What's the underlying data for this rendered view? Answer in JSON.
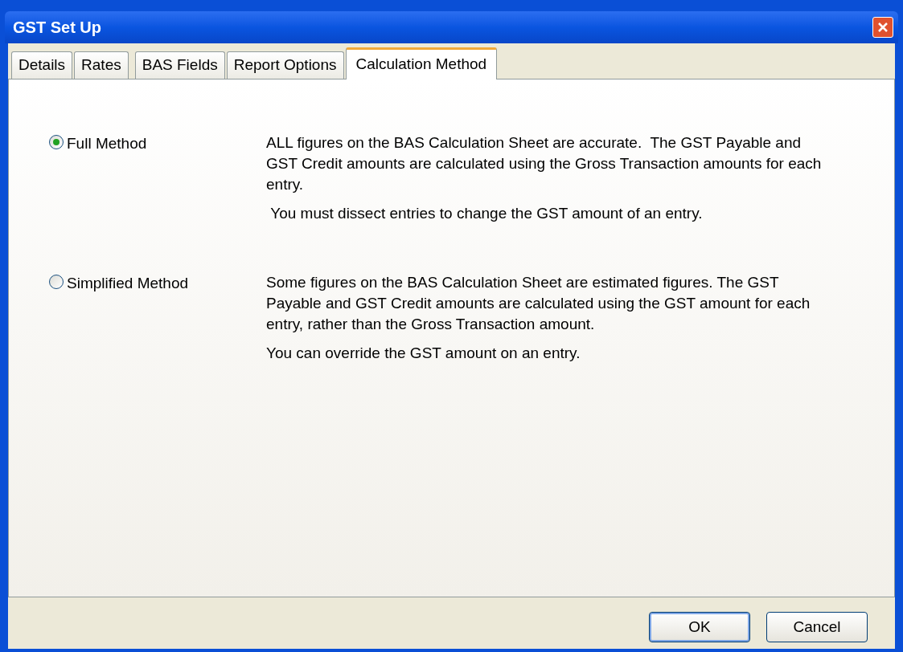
{
  "window": {
    "title": "GST Set Up"
  },
  "tabs": [
    {
      "label": "Details",
      "selected": false
    },
    {
      "label": "Rates",
      "selected": false
    },
    {
      "label": "BAS Fields",
      "selected": false
    },
    {
      "label": "Report Options",
      "selected": false
    },
    {
      "label": "Calculation Method",
      "selected": true
    }
  ],
  "methods": [
    {
      "label": "Full Method",
      "selected": true,
      "paragraphs": [
        "ALL figures on the BAS Calculation Sheet are accurate.  The GST Payable and GST Credit amounts are calculated using the Gross Transaction amounts for each entry.",
        " You must dissect entries to change the GST amount of an entry."
      ]
    },
    {
      "label": "Simplified Method",
      "selected": false,
      "paragraphs": [
        "Some figures on the BAS Calculation Sheet are estimated figures. The GST Payable and GST Credit amounts are calculated using the GST amount for each entry, rather than the Gross Transaction amount.",
        "You can override the GST amount on an entry."
      ]
    }
  ],
  "buttons": [
    {
      "label": "OK",
      "default": true
    },
    {
      "label": "Cancel",
      "default": false
    }
  ]
}
